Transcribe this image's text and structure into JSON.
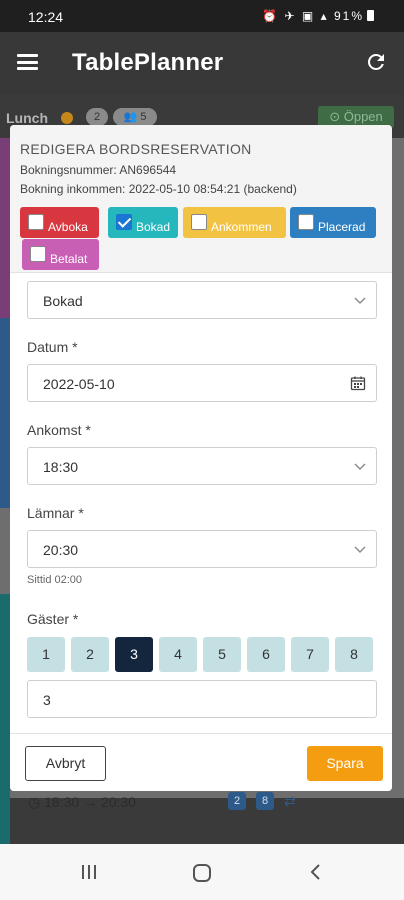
{
  "status_bar": {
    "time": "12:24",
    "battery": "91%"
  },
  "app_bar": {
    "title": "TablePlanner"
  },
  "background": {
    "lunch_label": "Lunch",
    "pill_count": "2",
    "pill_guests": "5",
    "open_label": "Öppen",
    "time_range": "18:30 → 20:30",
    "badges": [
      "2",
      "8"
    ]
  },
  "modal": {
    "title": "REDIGERA BORDSRESERVATION",
    "booking_number": "Bokningsnummer: AN696544",
    "booking_received": "Bokning inkommen: 2022-05-10 08:54:21 (backend)",
    "status_buttons": [
      {
        "label": "Avboka",
        "checked": false,
        "color": "#d9373f"
      },
      {
        "label": "Bokad",
        "checked": true,
        "color": "#26b7bc"
      },
      {
        "label": "Ankommen",
        "checked": false,
        "color": "#f2c243"
      },
      {
        "label": "Placerad",
        "checked": false,
        "color": "#2e7fc1"
      },
      {
        "label": "Betalat",
        "checked": false,
        "color": "#c95eb5"
      }
    ],
    "status_select_value": "Bokad",
    "date_label": "Datum *",
    "date_value": "2022-05-10",
    "arrival_label": "Ankomst *",
    "arrival_value": "18:30",
    "leave_label": "Lämnar *",
    "leave_value": "20:30",
    "duration_text": "Sittid 02:00",
    "guests_label": "Gäster *",
    "guest_buttons": [
      "1",
      "2",
      "3",
      "4",
      "5",
      "6",
      "7",
      "8"
    ],
    "guests_selected": "3",
    "guests_value": "3",
    "cancel_label": "Avbryt",
    "save_label": "Spara"
  },
  "colors": {
    "accent_save": "#f59d11",
    "guest_selected": "#13263d",
    "guest_default": "#c4e0e3",
    "app_bar": "#383838"
  }
}
